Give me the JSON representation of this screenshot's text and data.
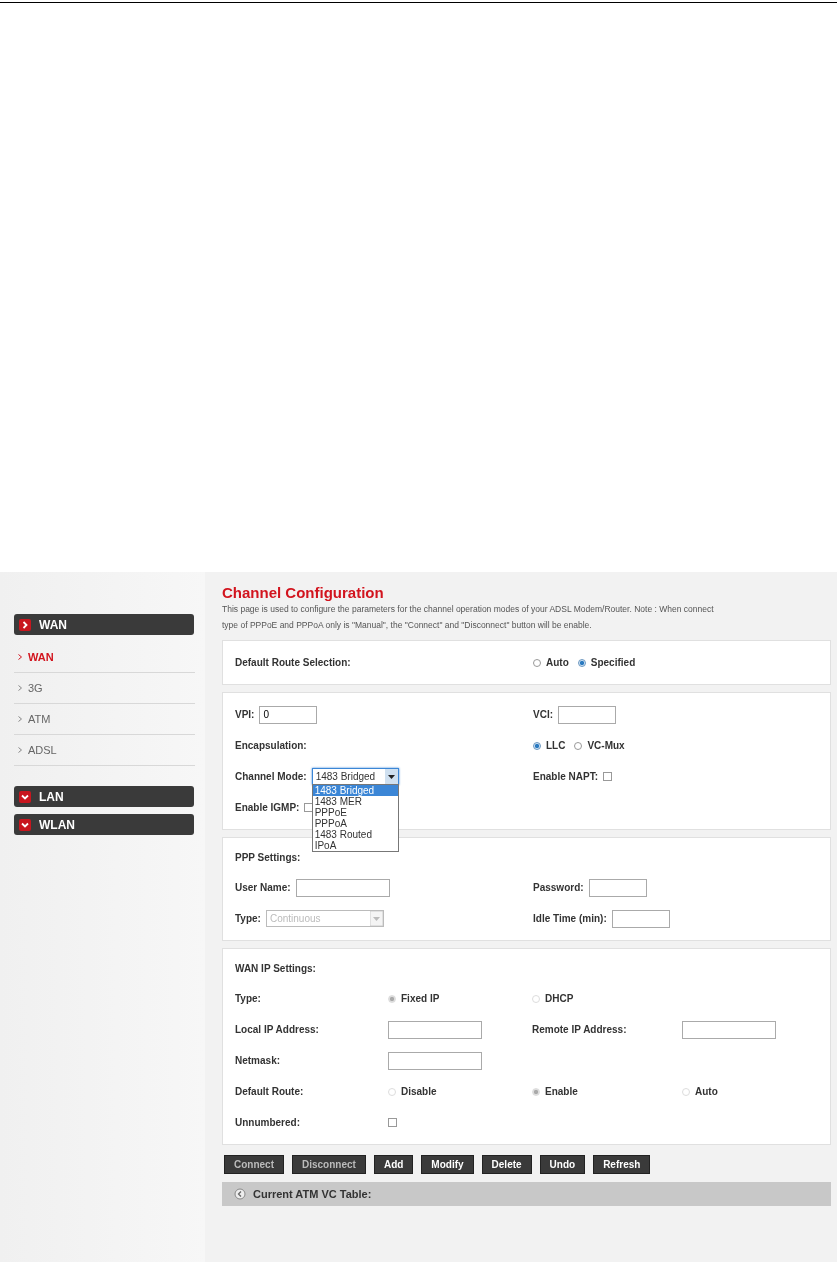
{
  "sidebar": {
    "groups": [
      {
        "label": "WAN",
        "expanded": true,
        "items": [
          {
            "label": "WAN",
            "selected": true
          },
          {
            "label": "3G",
            "selected": false
          },
          {
            "label": "ATM",
            "selected": false
          },
          {
            "label": "ADSL",
            "selected": false
          }
        ]
      },
      {
        "label": "LAN",
        "expanded": false
      },
      {
        "label": "WLAN",
        "expanded": false
      }
    ]
  },
  "title": "Channel Configuration",
  "description_lines": [
    "This page is used to configure the parameters for the channel operation modes of your ADSL Modem/Router. Note : When connect",
    "type of PPPoE and PPPoA only is \"Manual\", the \"Connect\" and \"Disconnect\" button will be enable."
  ],
  "default_route": {
    "label": "Default Route Selection:",
    "options": [
      {
        "label": "Auto",
        "selected": false
      },
      {
        "label": "Specified",
        "selected": true
      }
    ]
  },
  "channel": {
    "vpi": {
      "label": "VPI:",
      "value": "0"
    },
    "vci": {
      "label": "VCI:"
    },
    "encapsulation": {
      "label": "Encapsulation:",
      "options": [
        {
          "label": "LLC",
          "selected": true
        },
        {
          "label": "VC-Mux",
          "selected": false
        }
      ]
    },
    "channel_mode": {
      "label": "Channel Mode:",
      "value": "1483 Bridged",
      "expanded": true,
      "options": [
        {
          "label": "1483 Bridged",
          "selected": true
        },
        {
          "label": "1483 MER",
          "selected": false
        },
        {
          "label": "PPPoE",
          "selected": false
        },
        {
          "label": "PPPoA",
          "selected": false
        },
        {
          "label": "1483 Routed",
          "selected": false
        },
        {
          "label": "IPoA",
          "selected": false
        }
      ]
    },
    "enable_napt": {
      "label": "Enable NAPT:",
      "checked": false
    },
    "enable_igmp": {
      "label": "Enable IGMP:",
      "checked": false
    }
  },
  "ppp": {
    "title": "PPP Settings:",
    "user_name": {
      "label": "User Name:"
    },
    "password": {
      "label": "Password:"
    },
    "type": {
      "label": "Type:",
      "value": "Continuous",
      "disabled": true
    },
    "idle_time": {
      "label": "Idle Time (min):"
    }
  },
  "wan_ip": {
    "title": "WAN IP Settings:",
    "type": {
      "label": "Type:",
      "options": [
        {
          "label": "Fixed IP",
          "selected": true,
          "disabled": true
        },
        {
          "label": "DHCP",
          "selected": false,
          "disabled": true
        }
      ]
    },
    "local_ip": {
      "label": "Local IP Address:"
    },
    "remote_ip": {
      "label": "Remote IP Address:"
    },
    "netmask": {
      "label": "Netmask:"
    },
    "default_route": {
      "label": "Default Route:",
      "options": [
        {
          "label": "Disable",
          "selected": false,
          "disabled": true
        },
        {
          "label": "Enable",
          "selected": true,
          "disabled": true
        },
        {
          "label": "Auto",
          "selected": false,
          "disabled": true
        }
      ]
    },
    "unnumbered": {
      "label": "Unnumbered:",
      "checked": false
    }
  },
  "buttons": [
    {
      "label": "Connect",
      "disabled": true
    },
    {
      "label": "Disconnect",
      "disabled": true
    },
    {
      "label": "Add",
      "disabled": false
    },
    {
      "label": "Modify",
      "disabled": false
    },
    {
      "label": "Delete",
      "disabled": false
    },
    {
      "label": "Undo",
      "disabled": false
    },
    {
      "label": "Refresh",
      "disabled": false
    }
  ],
  "table": {
    "title": "Current ATM VC Table:"
  }
}
